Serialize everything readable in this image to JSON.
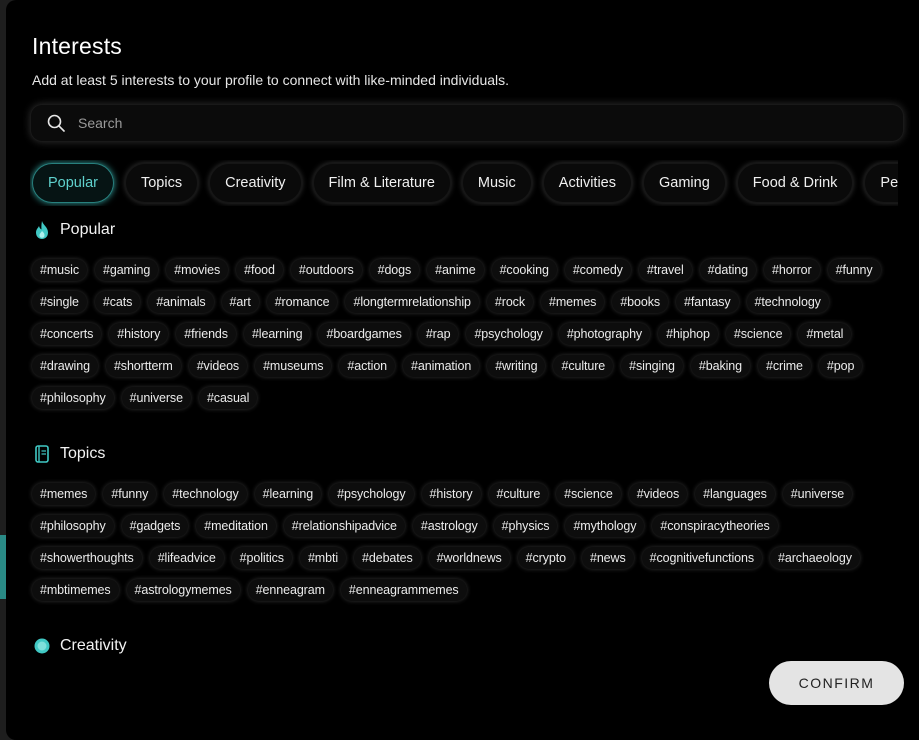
{
  "modal": {
    "title": "Interests",
    "subtitle": "Add at least 5 interests to your profile to connect with like-minded individuals.",
    "search_placeholder": "Search",
    "confirm_label": "CONFIRM"
  },
  "accent_color": "#40c8c4",
  "tabs": [
    {
      "label": "Popular",
      "active": true
    },
    {
      "label": "Topics"
    },
    {
      "label": "Creativity"
    },
    {
      "label": "Film & Literature"
    },
    {
      "label": "Music"
    },
    {
      "label": "Activities"
    },
    {
      "label": "Gaming"
    },
    {
      "label": "Food & Drink"
    },
    {
      "label": "Pets"
    }
  ],
  "sections": [
    {
      "title": "Popular",
      "icon": "flame-icon",
      "tags": [
        "#music",
        "#gaming",
        "#movies",
        "#food",
        "#outdoors",
        "#dogs",
        "#anime",
        "#cooking",
        "#comedy",
        "#travel",
        "#dating",
        "#horror",
        "#funny",
        "#single",
        "#cats",
        "#animals",
        "#art",
        "#romance",
        "#longtermrelationship",
        "#rock",
        "#memes",
        "#books",
        "#fantasy",
        "#technology",
        "#concerts",
        "#history",
        "#friends",
        "#learning",
        "#boardgames",
        "#rap",
        "#psychology",
        "#photography",
        "#hiphop",
        "#science",
        "#metal",
        "#drawing",
        "#shortterm",
        "#videos",
        "#museums",
        "#action",
        "#animation",
        "#writing",
        "#culture",
        "#singing",
        "#baking",
        "#crime",
        "#pop",
        "#philosophy",
        "#universe",
        "#casual"
      ]
    },
    {
      "title": "Topics",
      "icon": "book-icon",
      "tags": [
        "#memes",
        "#funny",
        "#technology",
        "#learning",
        "#psychology",
        "#history",
        "#culture",
        "#science",
        "#videos",
        "#languages",
        "#universe",
        "#philosophy",
        "#gadgets",
        "#meditation",
        "#relationshipadvice",
        "#astrology",
        "#physics",
        "#mythology",
        "#conspiracytheories",
        "#showerthoughts",
        "#lifeadvice",
        "#politics",
        "#mbti",
        "#debates",
        "#worldnews",
        "#crypto",
        "#news",
        "#cognitivefunctions",
        "#archaeology",
        "#mbtimemes",
        "#astrologymemes",
        "#enneagram",
        "#enneagrammemes"
      ]
    },
    {
      "title": "Creativity",
      "icon": "palette-icon",
      "tags": []
    }
  ]
}
